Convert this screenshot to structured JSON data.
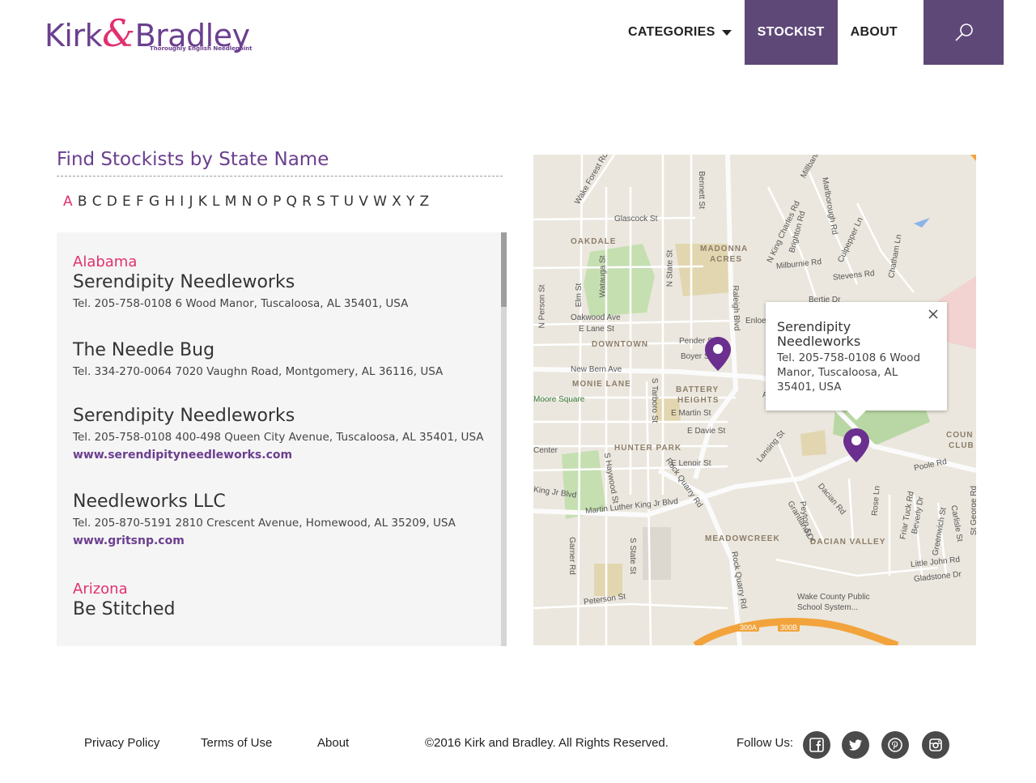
{
  "brand": {
    "name_part1": "Kirk",
    "name_amp": "&",
    "name_part2": "Bradley",
    "tagline": "Thoroughly English Needlepoint",
    "primary_color": "#6b3f8f",
    "accent_color": "#e0306f",
    "nav_active_color": "#5e4878"
  },
  "nav": {
    "categories": "CATEGORIES",
    "stockist": "STOCKIST",
    "about": "ABOUT",
    "search_icon": "search-icon"
  },
  "finder": {
    "title": "Find Stockists by State Name",
    "letters": [
      "A",
      "B",
      "C",
      "D",
      "E",
      "F",
      "G",
      "H",
      "I",
      "J",
      "K",
      "L",
      "M",
      "N",
      "O",
      "P",
      "Q",
      "R",
      "S",
      "T",
      "U",
      "V",
      "W",
      "X",
      "Y",
      "Z"
    ],
    "active_letter": "A"
  },
  "stockists": {
    "state_alabama": "Alabama",
    "s1": {
      "name": "Serendipity Needleworks",
      "info": "Tel. 205-758-0108 6 Wood Manor, Tuscaloosa, AL 35401, USA"
    },
    "s2": {
      "name": "The Needle Bug",
      "info": "Tel. 334-270-0064 7020 Vaughn Road, Montgomery, AL 36116, USA"
    },
    "s3": {
      "name": "Serendipity Needleworks",
      "info": "Tel. 205-758-0108 400-498 Queen City Avenue, Tuscaloosa, AL 35401, USA",
      "link": "www.serendipityneedleworks.com"
    },
    "s4": {
      "name": "Needleworks LLC",
      "info": "Tel. 205-870-5191 2810 Crescent Avenue, Homewood, AL 35209, USA",
      "link": "www.gritsnp.com"
    },
    "state_arizona": "Arizona",
    "s5": {
      "name": "Be Stitched"
    }
  },
  "map": {
    "popup": {
      "name": "Serendipity Needleworks",
      "info": "Tel. 205-758-0108 6 Wood Manor, Tuscaloosa, AL 35401, USA"
    },
    "areas": [
      "OAKDALE",
      "MADONNA ACRES",
      "DOWNTOWN",
      "MONIE LANE",
      "BATTERY HEIGHTS",
      "HUNTER PARK",
      "MEADOWCREEK",
      "DACIAN VALLEY",
      "COUNTRY CLUB"
    ],
    "streets": [
      "Glascock St",
      "Milburnie Rd",
      "Stevens Rd",
      "Oakwood Ave",
      "E Lane St",
      "Pender St",
      "Boyer St",
      "New Bern Ave",
      "Moore Square",
      "E Martin St",
      "E Davie St",
      "E Lenoir St",
      "Martin Luther King Jr Blvd",
      "Poole Rd",
      "Lansing St",
      "Dacian Rd",
      "Peterson St",
      "Little John Rd",
      "Gladstone Dr",
      "Wake County Public School System...",
      "Raleigh Blvd",
      "Rock Quarry Rd",
      "S Tarboro St",
      "S Haywood St",
      "Garner Rd",
      "S State St",
      "N Person St",
      "Elm St",
      "Watauga St",
      "N State St",
      "Bennett St",
      "Wake Forest Rd",
      "Brighton Rd",
      "Marlborough Rd",
      "Culpepper Ln",
      "Chatham Ln",
      "Bertie Dr",
      "Enloe",
      "Grantland Dr",
      "Peyton St",
      "Rose Ln",
      "Friar Tuck Rd",
      "Beverly Dr",
      "Greenwich St",
      "Carlisle St",
      "St George Rd",
      "Center",
      "King Jr Blvd",
      "N King Charles Rd",
      "Millbank",
      "300A",
      "300B"
    ]
  },
  "footer": {
    "privacy": "Privacy Policy",
    "terms": "Terms of Use",
    "about": "About",
    "copyright": "©2016 Kirk and Bradley. All Rights Reserved.",
    "follow": "Follow Us:",
    "social": [
      "facebook-icon",
      "twitter-icon",
      "pinterest-icon",
      "instagram-icon"
    ]
  }
}
